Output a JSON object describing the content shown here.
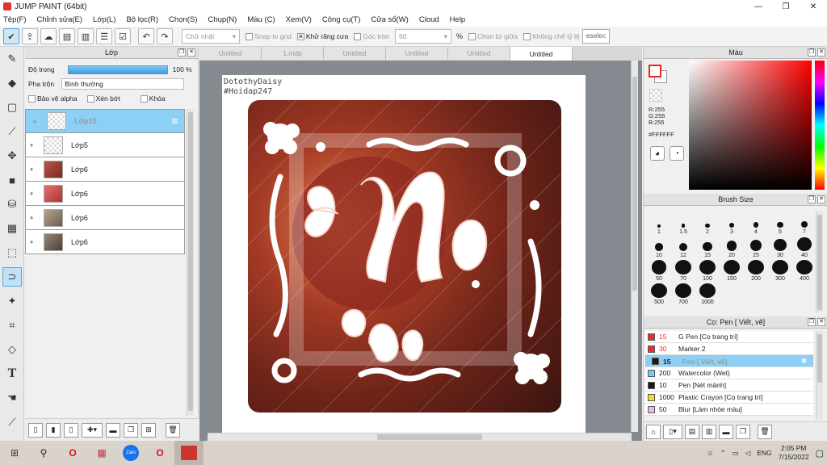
{
  "window": {
    "title": "JUMP PAINT (64bit)",
    "minimize": "—",
    "restore": "❐",
    "close": "✕"
  },
  "menu": [
    "Tệp(F)",
    "Chỉnh sửa(E)",
    "Lớp(L)",
    "Bộ lọc(R)",
    "Chọn(S)",
    "Chụp(N)",
    "Màu (C)",
    "Xem(V)",
    "Công cụ(T)",
    "Cửa sổ(W)",
    "Cloud",
    "Help"
  ],
  "toolbar": {
    "shape_select": "Chữ nhật",
    "snap_grid": "Snap to grid",
    "antialias": "Khử răng cưa",
    "round_corner": "Góc tròn",
    "round_value": "60",
    "percent": "%",
    "select_center": "Chọn từ giữa",
    "constrain_ratio": "Không chế tỷ lệ",
    "deselect": "eselec"
  },
  "layers_panel": {
    "title": "Lớp",
    "opacity_label": "Độ trong",
    "opacity_value": "100 %",
    "blend_label": "Pha trộn",
    "blend_value": "Bình thường",
    "protect_alpha": "Bảo vệ alpha",
    "clipping": "Xén bớt",
    "lock": "Khóa",
    "items": [
      {
        "name": "Lớp13",
        "selected": true
      },
      {
        "name": "Lớp5"
      },
      {
        "name": "Lớp6"
      },
      {
        "name": "Lớp6"
      },
      {
        "name": "Lớp6"
      },
      {
        "name": "Lớp6"
      }
    ]
  },
  "tabs": [
    "Untitled",
    "1.mdp",
    "Untitled",
    "Untitled",
    "Untitled",
    "Untitled"
  ],
  "canvas": {
    "signature_1": "DotothyDaisy",
    "signature_2": "#Hoidap247"
  },
  "color_panel": {
    "title": "Màu",
    "r": "R:255",
    "g": "G:255",
    "b": "B:255",
    "hex": "#FFFFFF",
    "fg": "#ffffff",
    "accent": "#e02020"
  },
  "brush_size": {
    "title": "Brush Size",
    "sizes": [
      "1",
      "1.5",
      "2",
      "3",
      "4",
      "5",
      "7",
      "10",
      "12",
      "15",
      "20",
      "25",
      "30",
      "40",
      "50",
      "70",
      "100",
      "150",
      "200",
      "300",
      "400",
      "500",
      "700",
      "1000"
    ]
  },
  "pen_panel": {
    "title": "Cọ: Pen [ Viết, vẽ]",
    "items": [
      {
        "size": "15",
        "name": "G Pen [Cọ trang trí]",
        "color": "#e53030"
      },
      {
        "size": "30",
        "name": "Marker 2",
        "color": "#e53030"
      },
      {
        "size": "15",
        "name": "Pen [ Viết, vẽ]",
        "color": "#1a1a1a",
        "selected": true
      },
      {
        "size": "200",
        "name": "Watercolor (Wet)",
        "color": "#70d0f0"
      },
      {
        "size": "10",
        "name": "Pen [Nét mảnh]",
        "color": "#1a1a1a"
      },
      {
        "size": "1000",
        "name": "Plastic Crayon [Cọ trang trí]",
        "color": "#f0e020"
      },
      {
        "size": "50",
        "name": "Blur [Làm nhòe màu]",
        "color": "#f6b6e0"
      }
    ]
  },
  "taskbar": {
    "lang": "ENG",
    "time": "2:05 PM",
    "date": "7/15/2022"
  }
}
